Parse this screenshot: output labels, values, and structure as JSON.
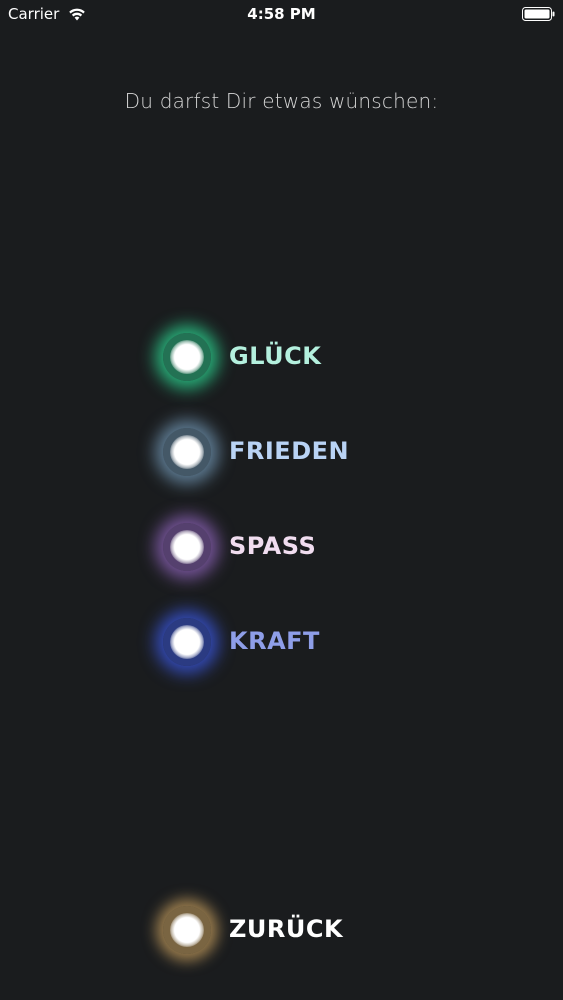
{
  "status_bar": {
    "carrier": "Carrier",
    "time": "4:58 PM",
    "wifi_icon": "wifi-icon",
    "battery_icon": "battery-icon"
  },
  "prompt": "Du darfst Dir etwas wünschen:",
  "options": [
    {
      "label": "GLÜCK",
      "color": "#2edc96",
      "icon": "glowing-orb-icon"
    },
    {
      "label": "FRIEDEN",
      "color": "#96c8f0",
      "icon": "glowing-orb-icon"
    },
    {
      "label": "SPASS",
      "color": "#af78e6",
      "icon": "glowing-orb-icon"
    },
    {
      "label": "KRAFT",
      "color": "#3c5ae6",
      "icon": "glowing-orb-icon"
    }
  ],
  "back": {
    "label": "ZURÜCK",
    "color": "#f0be6e",
    "icon": "glowing-orb-icon"
  },
  "colors": {
    "background": "#1a1c1e",
    "prompt_text": "#d6d6d6"
  }
}
